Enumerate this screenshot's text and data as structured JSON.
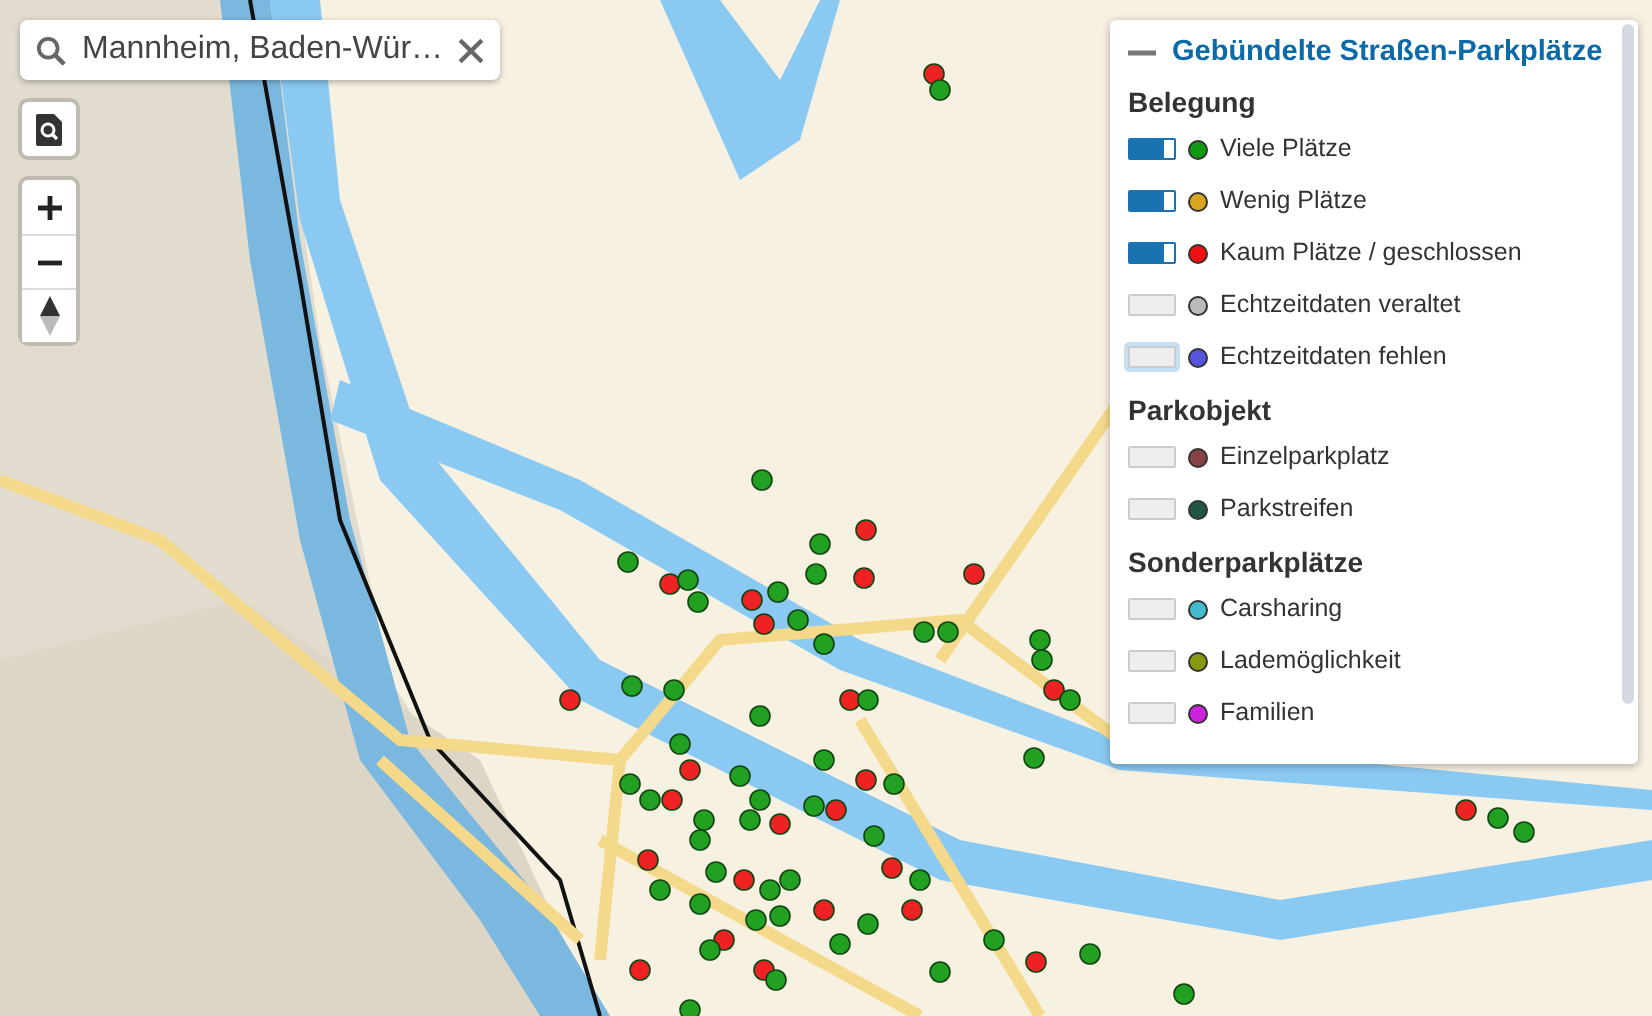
{
  "search": {
    "value": "Mannheim, Baden-Wür…"
  },
  "legend": {
    "title": "Gebündelte Straßen-Parkplätze",
    "expanded": true,
    "sections": [
      {
        "heading": "Belegung",
        "items": [
          {
            "label": "Viele Plätze",
            "on": true,
            "focused": false,
            "color": "#119911"
          },
          {
            "label": "Wenig Plätze",
            "on": true,
            "focused": false,
            "color": "#d9a520"
          },
          {
            "label": "Kaum Plätze / geschlossen",
            "on": true,
            "focused": false,
            "color": "#ee1111"
          },
          {
            "label": "Echtzeitdaten veraltet",
            "on": false,
            "focused": false,
            "color": "#bbbbbb"
          },
          {
            "label": "Echtzeitdaten fehlen",
            "on": false,
            "focused": true,
            "color": "#5555dd"
          }
        ]
      },
      {
        "heading": "Parkobjekt",
        "items": [
          {
            "label": "Einzelparkplatz",
            "on": false,
            "focused": false,
            "color": "#884444"
          },
          {
            "label": "Parkstreifen",
            "on": false,
            "focused": false,
            "color": "#225544"
          }
        ]
      },
      {
        "heading": "Sonderparkplätze",
        "items": [
          {
            "label": "Carsharing",
            "on": false,
            "focused": false,
            "color": "#44bbcc"
          },
          {
            "label": "Lademöglichkeit",
            "on": false,
            "focused": false,
            "color": "#889911"
          },
          {
            "label": "Familien",
            "on": false,
            "focused": false,
            "color": "#cc22dd"
          }
        ]
      }
    ]
  }
}
